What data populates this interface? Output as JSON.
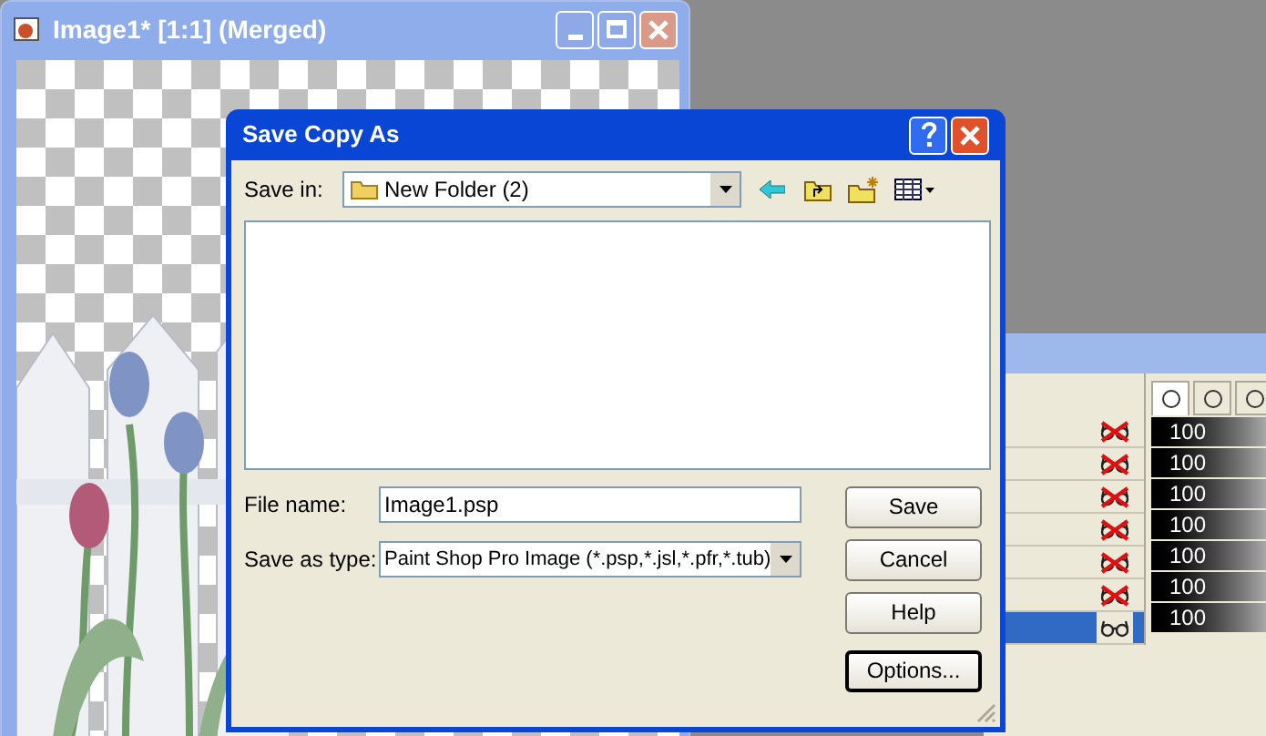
{
  "image_window": {
    "title": "Image1* [1:1] (Merged)",
    "kind": "picture"
  },
  "dialog": {
    "title": "Save Copy As",
    "save_in": {
      "label": "Save in:",
      "value": "New Folder (2)"
    },
    "file_name": {
      "label": "File name:",
      "value": "Image1.psp"
    },
    "save_as_type": {
      "label": "Save as type:",
      "value": "Paint Shop Pro Image (*.psp,*.jsl,*.pfr,*.tub)"
    },
    "buttons": [
      {
        "label": "Save",
        "focused": false
      },
      {
        "label": "Cancel",
        "focused": false
      },
      {
        "label": "Help",
        "focused": false
      },
      {
        "label": "Options...",
        "focused": true
      }
    ]
  },
  "layers": {
    "tabs": [
      {
        "selected": true
      },
      {
        "selected": false
      },
      {
        "selected": false
      }
    ],
    "rows": [
      {
        "visible": false,
        "selected": false,
        "opacity": "100"
      },
      {
        "visible": false,
        "selected": false,
        "opacity": "100"
      },
      {
        "visible": false,
        "selected": false,
        "opacity": "100"
      },
      {
        "visible": false,
        "selected": false,
        "opacity": "100"
      },
      {
        "visible": false,
        "selected": false,
        "opacity": "100"
      },
      {
        "visible": false,
        "selected": false,
        "opacity": "100"
      },
      {
        "visible": true,
        "selected": true,
        "opacity": "100"
      }
    ]
  }
}
